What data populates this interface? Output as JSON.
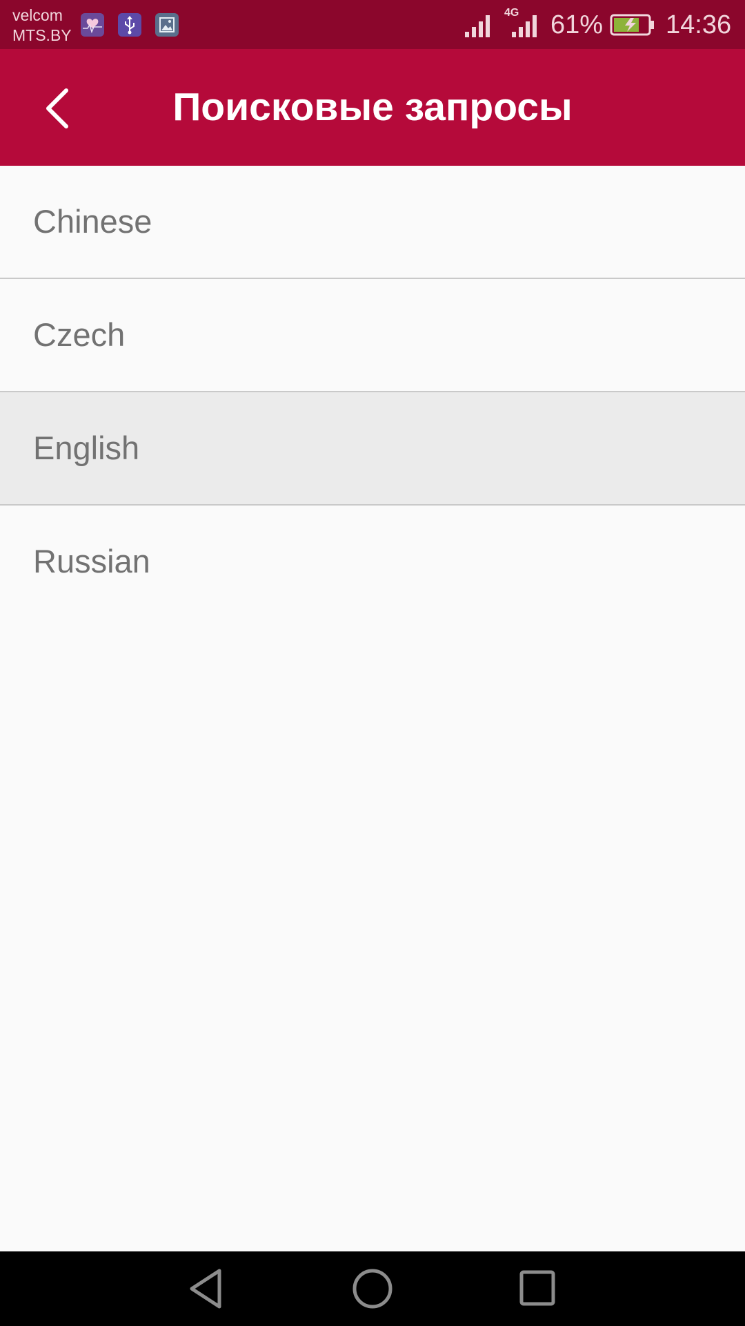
{
  "status_bar": {
    "carrier_primary": "velcom",
    "carrier_secondary": "MTS.BY",
    "network_type": "4G",
    "battery_percent": "61%",
    "time": "14:36",
    "notification_icons": [
      "health-icon",
      "usb-icon",
      "gallery-icon"
    ],
    "colors": {
      "background": "#8b062c",
      "battery_fill": "#8db33a"
    }
  },
  "app_bar": {
    "title": "Поисковые запросы",
    "back_icon": "chevron-left-icon",
    "background": "#b50a3a"
  },
  "languages": {
    "items": [
      {
        "label": "Chinese",
        "selected": false
      },
      {
        "label": "Czech",
        "selected": false
      },
      {
        "label": "English",
        "selected": true
      },
      {
        "label": "Russian",
        "selected": false
      }
    ]
  },
  "nav_bar": {
    "icons": [
      "back-triangle-icon",
      "home-circle-icon",
      "recents-square-icon"
    ]
  }
}
